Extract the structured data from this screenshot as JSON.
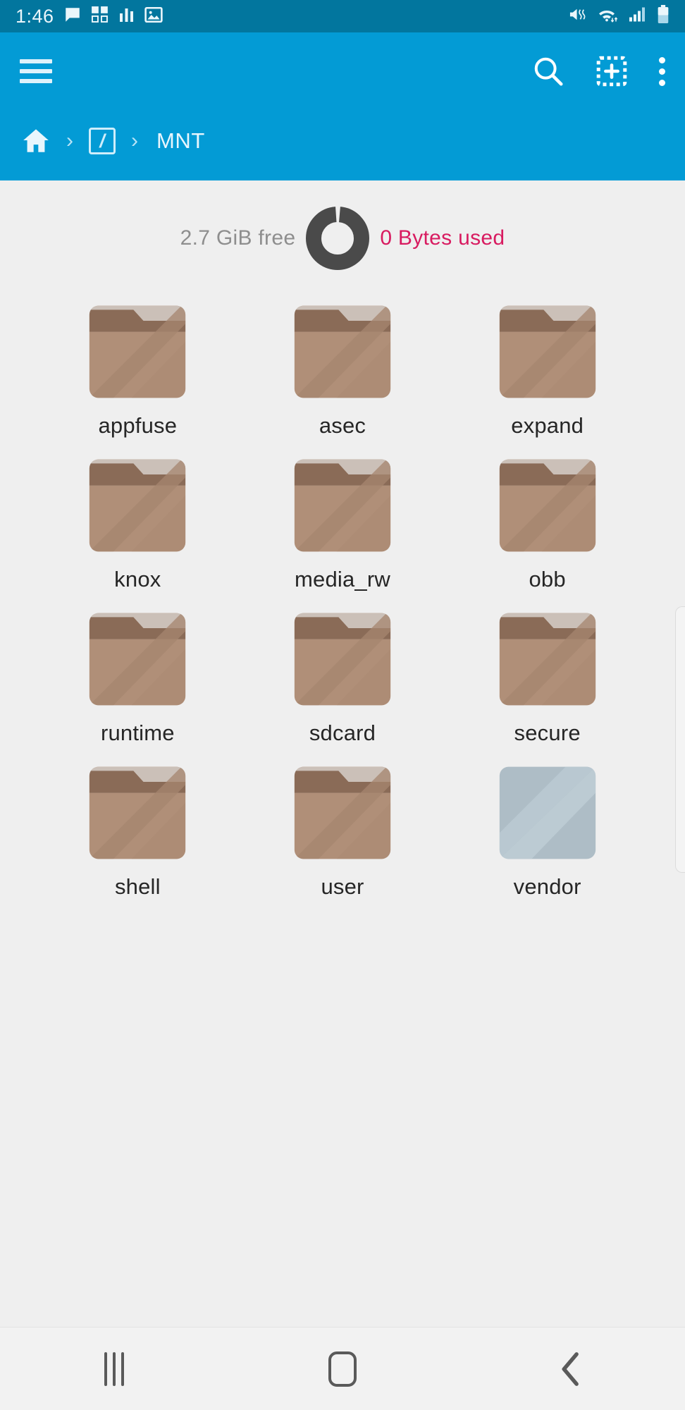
{
  "statusbar": {
    "time": "1:46",
    "left_icons": [
      "message-icon",
      "multiwindow-icon",
      "equalizer-icon",
      "gallery-icon"
    ],
    "right_icons": [
      "mute-vibrate-icon",
      "wifi-icon",
      "signal-icon",
      "battery-icon"
    ],
    "background": "#02769e"
  },
  "appbar": {
    "background": "#039bd5",
    "menu_label": "hamburger-menu",
    "actions": [
      {
        "name": "search-button",
        "icon": "search-icon"
      },
      {
        "name": "new-item-button",
        "icon": "add-dashed-box-icon"
      },
      {
        "name": "overflow-button",
        "icon": "more-vertical-icon"
      }
    ]
  },
  "breadcrumb": {
    "home_icon": "home-icon",
    "root_label": "/",
    "separator": "›",
    "current": "MNT"
  },
  "storage": {
    "free_text": "2.7 GiB free",
    "used_text": "0 Bytes used",
    "free_color": "#8e8e8e",
    "used_color": "#d81b60",
    "ring_color": "#4a4a4a",
    "used_percent": 0
  },
  "folders": [
    {
      "label": "appfuse",
      "type": "folder"
    },
    {
      "label": "asec",
      "type": "folder"
    },
    {
      "label": "expand",
      "type": "folder"
    },
    {
      "label": "knox",
      "type": "folder"
    },
    {
      "label": "media_rw",
      "type": "folder"
    },
    {
      "label": "obb",
      "type": "folder"
    },
    {
      "label": "runtime",
      "type": "folder"
    },
    {
      "label": "sdcard",
      "type": "folder"
    },
    {
      "label": "secure",
      "type": "folder"
    },
    {
      "label": "shell",
      "type": "folder"
    },
    {
      "label": "user",
      "type": "folder"
    },
    {
      "label": "vendor",
      "type": "blank"
    }
  ],
  "navbar": {
    "recents_label": "recents-button",
    "home_label": "home-button",
    "back_label": "back-button"
  }
}
